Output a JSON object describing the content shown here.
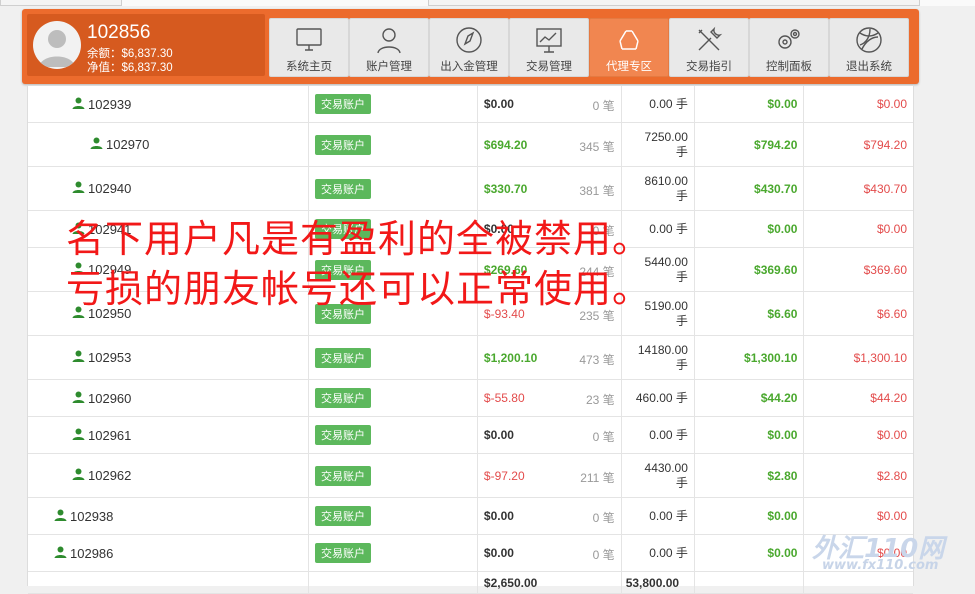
{
  "user": {
    "id": "102856",
    "balance_line": "余额：$6,837.30",
    "equity_line": "净值：$6,837.30"
  },
  "nav": [
    {
      "label": "系统主页",
      "icon": "monitor-icon",
      "active": false
    },
    {
      "label": "账户管理",
      "icon": "user-outline-icon",
      "active": false
    },
    {
      "label": "出入金管理",
      "icon": "compass-icon",
      "active": false
    },
    {
      "label": "交易管理",
      "icon": "chart-board-icon",
      "active": false
    },
    {
      "label": "代理专区",
      "icon": "recycle-icon",
      "active": true
    },
    {
      "label": "交易指引",
      "icon": "tools-icon",
      "active": false
    },
    {
      "label": "控制面板",
      "icon": "gears-icon",
      "active": false
    },
    {
      "label": "退出系统",
      "icon": "ball-icon",
      "active": false
    }
  ],
  "badge_label": "交易账户",
  "rows": [
    {
      "user": "102939",
      "indent": 1,
      "amount": "$0.00",
      "amount_tone": "black",
      "count": "0 笔",
      "hands": [
        "0.00 手"
      ],
      "green": "$0.00",
      "red": "$0.00"
    },
    {
      "user": "102970",
      "indent": 2,
      "amount": "$694.20",
      "amount_tone": "green",
      "count": "345 笔",
      "hands": [
        "7250.00",
        "手"
      ],
      "green": "$794.20",
      "red": "$794.20"
    },
    {
      "user": "102940",
      "indent": 1,
      "amount": "$330.70",
      "amount_tone": "green",
      "count": "381 笔",
      "hands": [
        "8610.00",
        "手"
      ],
      "green": "$430.70",
      "red": "$430.70"
    },
    {
      "user": "102941",
      "indent": 1,
      "amount": "$0.00",
      "amount_tone": "black",
      "count": "0 笔",
      "hands": [
        "0.00 手"
      ],
      "green": "$0.00",
      "red": "$0.00"
    },
    {
      "user": "102949",
      "indent": 1,
      "amount": "$269.60",
      "amount_tone": "green",
      "count": "244 笔",
      "hands": [
        "5440.00",
        "手"
      ],
      "green": "$369.60",
      "red": "$369.60"
    },
    {
      "user": "102950",
      "indent": 1,
      "amount": "$-93.40",
      "amount_tone": "red",
      "count": "235 笔",
      "hands": [
        "5190.00",
        "手"
      ],
      "green": "$6.60",
      "red": "$6.60"
    },
    {
      "user": "102953",
      "indent": 1,
      "amount": "$1,200.10",
      "amount_tone": "green",
      "count": "473 笔",
      "hands": [
        "14180.00",
        "手"
      ],
      "green": "$1,300.10",
      "red": "$1,300.10"
    },
    {
      "user": "102960",
      "indent": 1,
      "amount": "$-55.80",
      "amount_tone": "red",
      "count": "23 笔",
      "hands": [
        "460.00 手"
      ],
      "green": "$44.20",
      "red": "$44.20"
    },
    {
      "user": "102961",
      "indent": 1,
      "amount": "$0.00",
      "amount_tone": "black",
      "count": "0 笔",
      "hands": [
        "0.00 手"
      ],
      "green": "$0.00",
      "red": "$0.00"
    },
    {
      "user": "102962",
      "indent": 1,
      "amount": "$-97.20",
      "amount_tone": "red",
      "count": "211 笔",
      "hands": [
        "4430.00",
        "手"
      ],
      "green": "$2.80",
      "red": "$2.80"
    },
    {
      "user": "102938",
      "indent": 0,
      "amount": "$0.00",
      "amount_tone": "black",
      "count": "0 笔",
      "hands": [
        "0.00 手"
      ],
      "green": "$0.00",
      "red": "$0.00"
    },
    {
      "user": "102986",
      "indent": 0,
      "amount": "$0.00",
      "amount_tone": "black",
      "count": "0 笔",
      "hands": [
        "0.00 手"
      ],
      "green": "$0.00",
      "red": "$0.00"
    }
  ],
  "totals": {
    "amount": "$2,650.00",
    "hands": "53,800.00"
  },
  "overlay": {
    "line1": "名下用户凡是有盈利的全被禁用。",
    "line2": "亏损的朋友帐号还可以正常使用。"
  },
  "watermark": {
    "main": "外汇110网",
    "url": "www.fx110.com"
  },
  "colors": {
    "header": "#ec6b2d",
    "active_tab": "#f18650",
    "badge": "#5cb85c",
    "green": "#4aa82e",
    "red": "#e34b4b",
    "overlay": "#f21818"
  }
}
